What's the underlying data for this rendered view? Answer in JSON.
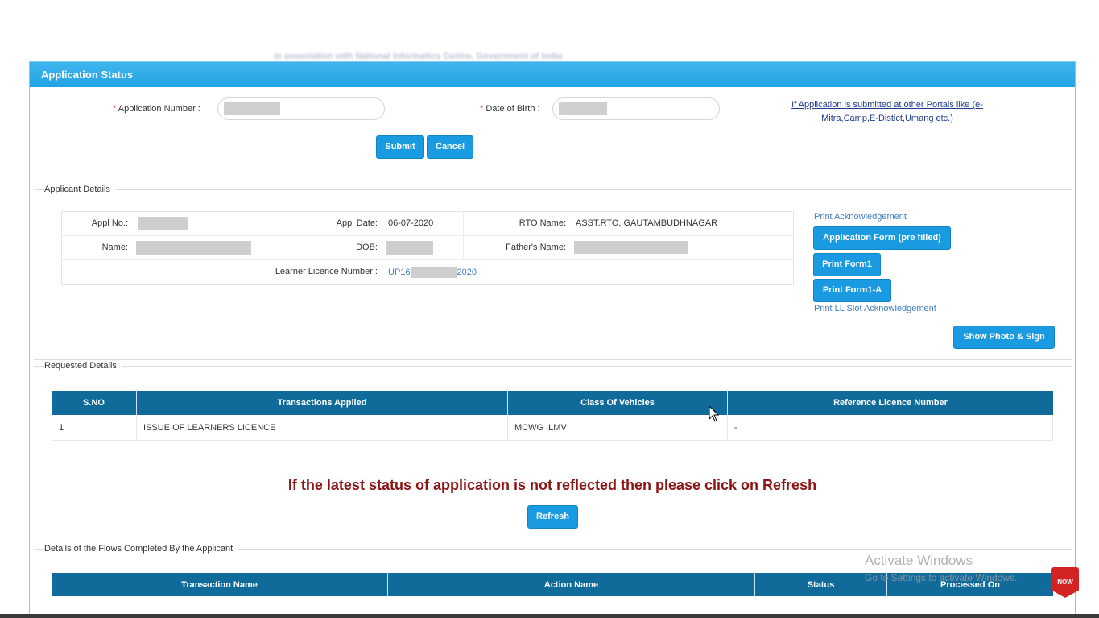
{
  "header_blur_text": "in association with National Informatics Centre, Government of India",
  "panel": {
    "title": "Application Status"
  },
  "form": {
    "app_number_label": "Application Number :",
    "dob_label": "Date of Birth :",
    "portal_link": "If Application is submitted at other Portals like (e-Mitra,Camp,E-Distict,Umang etc.)",
    "submit_label": "Submit",
    "cancel_label": "Cancel"
  },
  "applicant": {
    "legend": "Applicant Details",
    "appl_no_label": "Appl No.:",
    "appl_date_label": "Appl Date:",
    "appl_date": "06-07-2020",
    "rto_label": "RTO Name:",
    "rto_name": "ASST.RTO, GAUTAMBUDHNAGAR",
    "name_label": "Name:",
    "dob_label": "DOB:",
    "father_label": "Father's Name:",
    "ll_label": "Learner Licence Number :",
    "ll_prefix": "UP16",
    "ll_suffix": "2020"
  },
  "side": {
    "print_ack": "Print Acknowledgement",
    "app_form": "Application Form (pre filled)",
    "print_form1": "Print Form1",
    "print_form1a": "Print Form1-A",
    "print_ll_slot": "Print LL Slot Acknowledgement",
    "show_photo": "Show Photo & Sign"
  },
  "requested": {
    "legend": "Requested Details",
    "headers": [
      "S.NO",
      "Transactions Applied",
      "Class Of Vehicles",
      "Reference Licence Number"
    ],
    "rows": [
      {
        "sno": "1",
        "transaction": "ISSUE OF LEARNERS LICENCE",
        "cov": "MCWG ,LMV",
        "ref": "-"
      }
    ]
  },
  "refresh": {
    "message": "If the latest status of application is not reflected then please click on Refresh",
    "button": "Refresh"
  },
  "flows": {
    "legend": "Details of the Flows Completed By the Applicant",
    "headers": [
      "Transaction Name",
      "Action Name",
      "Status",
      "Processed On"
    ]
  },
  "watermark": {
    "line1": "Activate Windows",
    "line2": "Go to Settings to activate Windows."
  },
  "badge": {
    "text": "NOW"
  }
}
